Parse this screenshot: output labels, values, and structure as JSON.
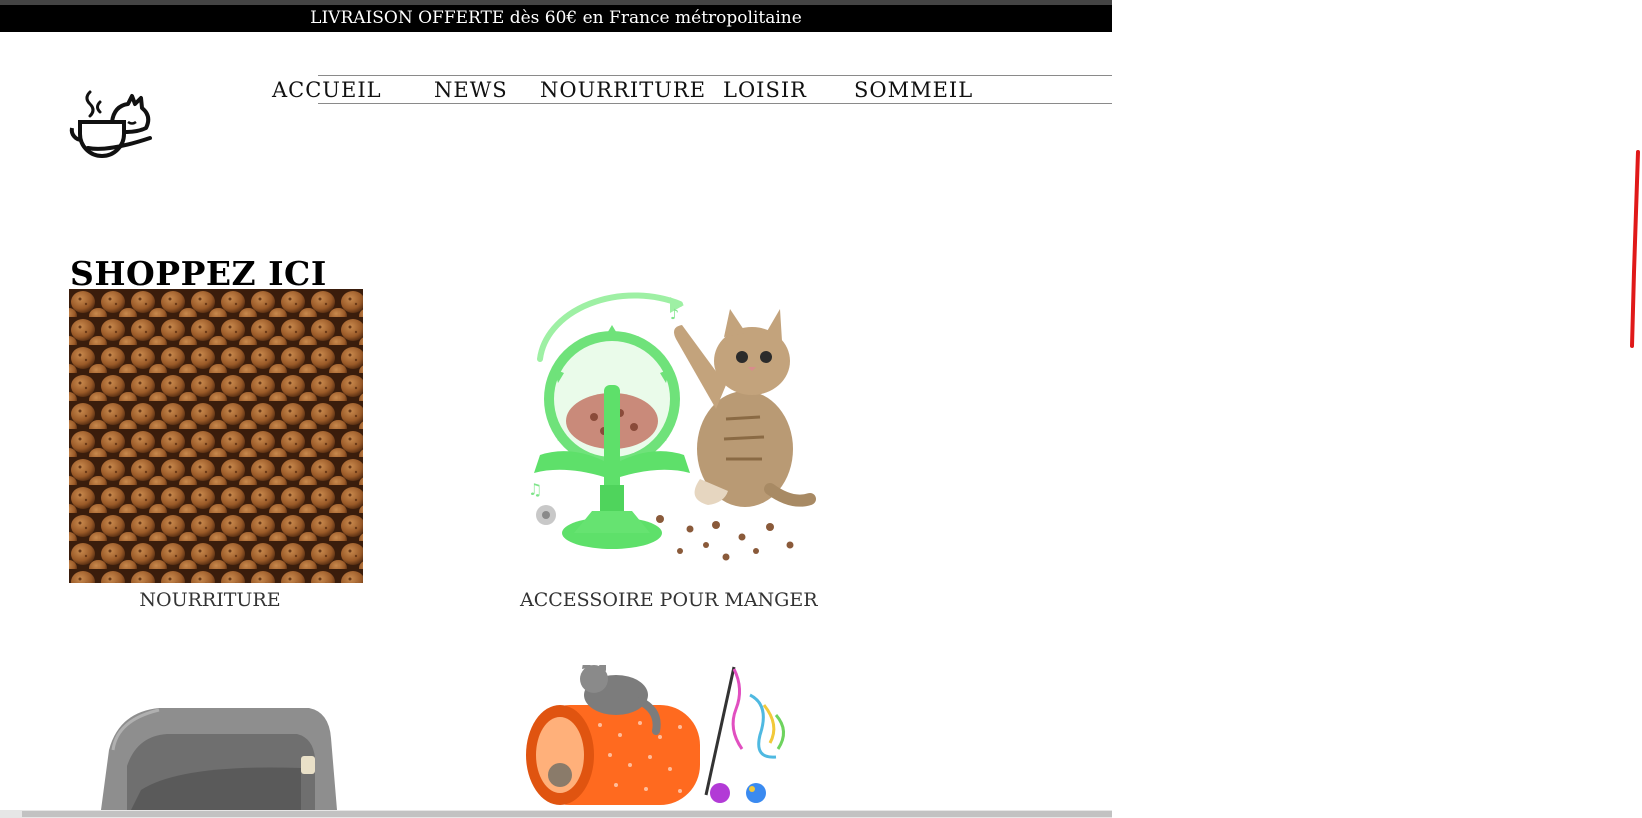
{
  "announcement": {
    "text": "LIVRAISON OFFERTE dès 60€ en France métropolitaine"
  },
  "logo": {
    "icon": "cat-on-coffee-cup-icon"
  },
  "nav": {
    "items": [
      {
        "label": "ACCUEIL"
      },
      {
        "label": "NEWS"
      },
      {
        "label": "NOURRITURE"
      },
      {
        "label": "LOISIR"
      },
      {
        "label": "SOMMEIL"
      }
    ]
  },
  "shop": {
    "title": "SHOPPEZ ICI",
    "tiles": [
      {
        "caption": "NOURRITURE",
        "image": "cat-kibble-image"
      },
      {
        "caption": "ACCESSOIRE POUR MANGER",
        "image": "cat-feeder-wheel-image"
      },
      {
        "caption": "",
        "image": "cat-bed-image"
      },
      {
        "caption": "",
        "image": "cat-tunnel-toys-image"
      }
    ]
  },
  "colors": {
    "announcement_bg": "#000000",
    "announcement_text": "#ffffff",
    "nav_text": "#111111",
    "feeder_green": "#5ee06a",
    "tunnel_orange": "#ff6a1f",
    "kibble_brown": "#a0612e",
    "annotation_red": "#e01919"
  }
}
